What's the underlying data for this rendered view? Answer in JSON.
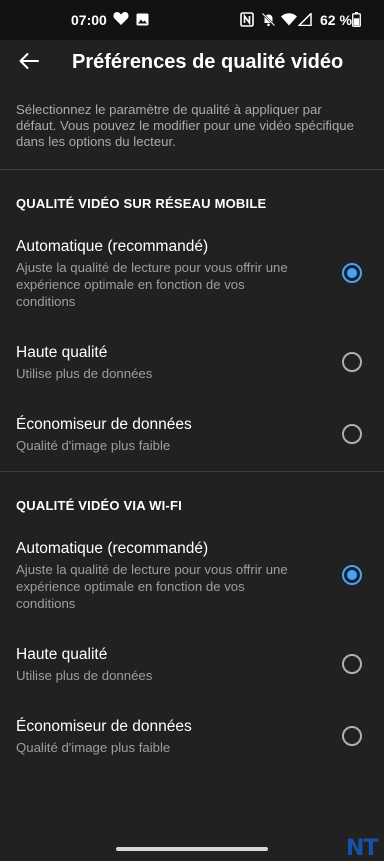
{
  "status_bar": {
    "time": "07:00",
    "battery_percent": "62 %",
    "icons": [
      "heart-icon",
      "image-icon",
      "nfc-icon",
      "bell-off-icon",
      "wifi-icon",
      "signal-icon",
      "battery-icon"
    ]
  },
  "app_bar": {
    "back_icon": "arrow-left-icon",
    "title": "Préférences de qualité vidéo"
  },
  "description": "Sélectionnez le paramètre de qualité à appliquer par défaut. Vous pouvez le modifier pour une vidéo spécifique dans les options du lecteur.",
  "sections": [
    {
      "header": "QUALITÉ VIDÉO SUR RÉSEAU MOBILE",
      "options": [
        {
          "title": "Automatique (recommandé)",
          "desc": "Ajuste la qualité de lecture pour vous offrir une expérience optimale en fonction de vos conditions",
          "selected": true
        },
        {
          "title": "Haute qualité",
          "desc": "Utilise plus de données",
          "selected": false
        },
        {
          "title": "Économiseur de données",
          "desc": "Qualité d'image plus faible",
          "selected": false
        }
      ]
    },
    {
      "header": "QUALITÉ VIDÉO VIA WI-FI",
      "options": [
        {
          "title": "Automatique (recommandé)",
          "desc": "Ajuste la qualité de lecture pour vous offrir une expérience optimale en fonction de vos conditions",
          "selected": true
        },
        {
          "title": "Haute qualité",
          "desc": "Utilise plus de données",
          "selected": false
        },
        {
          "title": "Économiseur de données",
          "desc": "Qualité d'image plus faible",
          "selected": false
        }
      ]
    }
  ],
  "watermark": "NT",
  "colors": {
    "accent": "#3ea6ff",
    "background": "#212121",
    "status_bar": "#121212"
  }
}
